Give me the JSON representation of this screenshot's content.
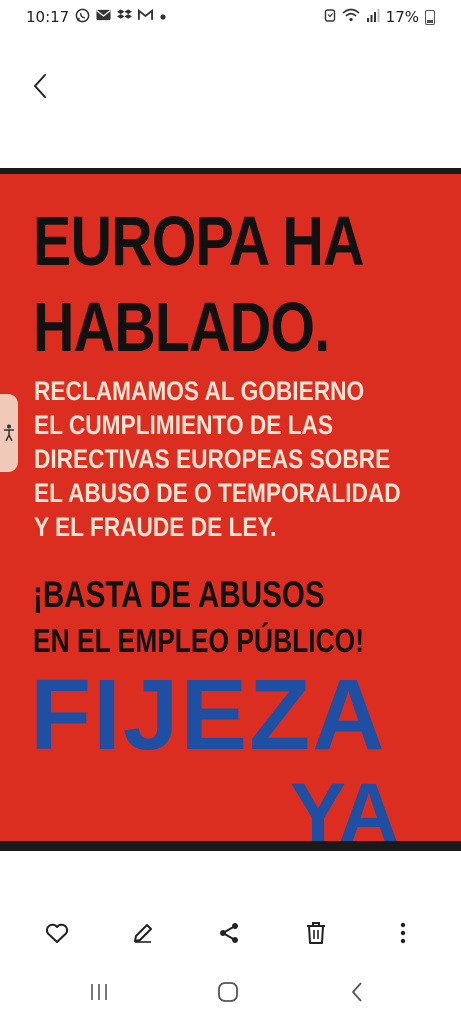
{
  "status_bar": {
    "time": "10:17",
    "battery": "17%",
    "notification_icons": [
      "whatsapp-icon",
      "mail-icon",
      "dropbox-icon",
      "gmail-icon",
      "dot-icon"
    ],
    "system_icons": [
      "alarm-icon",
      "wifi-icon",
      "signal-icon",
      "battery-icon"
    ]
  },
  "poster": {
    "headline_line1": "EUROPA HA",
    "headline_line2": "HABLADO.",
    "body_line1": "RECLAMAMOS AL GOBIERNO",
    "body_line2": "EL CUMPLIMIENTO DE LAS",
    "body_line3": "DIRECTIVAS EUROPEAS SOBRE",
    "body_line4": "EL ABUSO DE O TEMPORALIDAD",
    "body_line5": "Y EL FRAUDE DE LEY.",
    "slogan_line1": "¡BASTA DE ABUSOS",
    "slogan_line2": "EN EL EMPLEO PÚBLICO!",
    "fijeza": "FIJEZA",
    "ya": "YA",
    "colors": {
      "background": "#dc2d21",
      "headline": "#111111",
      "body": "#fbe4d4",
      "accent": "#1f4fa2"
    }
  },
  "toolbar": {
    "icons": [
      "heart-icon",
      "edit-icon",
      "share-icon",
      "delete-icon",
      "more-icon"
    ]
  },
  "navbar": {
    "icons": [
      "recent-apps-icon",
      "home-icon",
      "back-icon"
    ]
  }
}
